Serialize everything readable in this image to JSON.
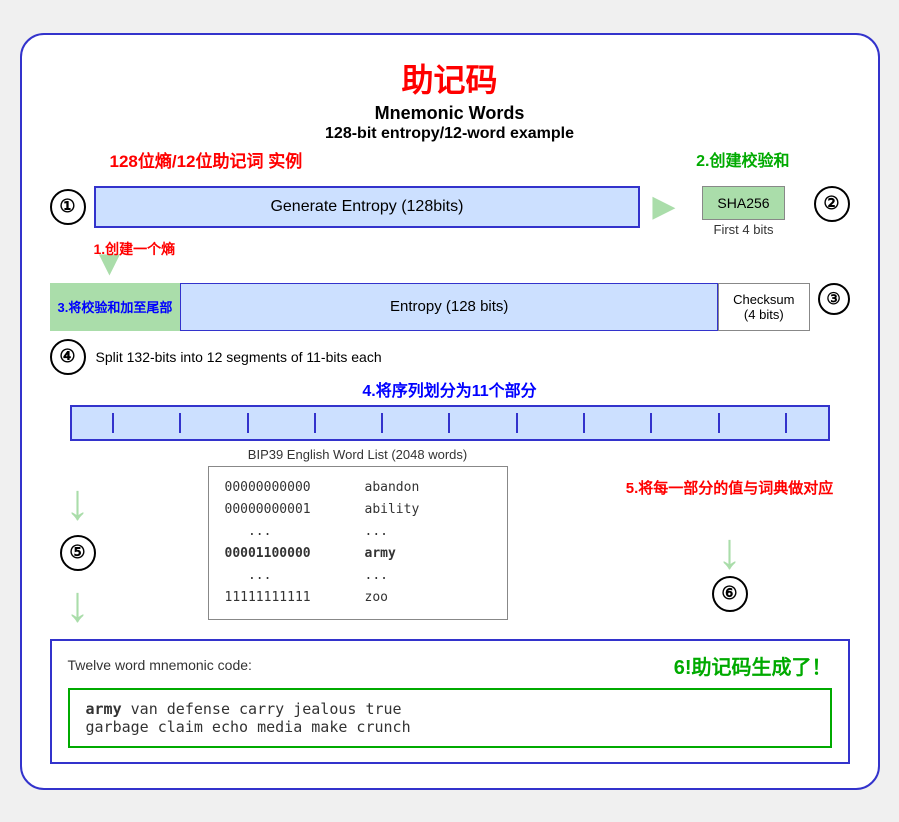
{
  "title": {
    "cn": "助记码",
    "en1": "Mnemonic Words",
    "en2": "128-bit entropy/12-word example",
    "cn2_left": "128位熵/12位助记词 实例",
    "cn2_right": "2.创建校验和"
  },
  "steps": {
    "step1_label": "1.创建一个熵",
    "step2_label": "2.创建校验和",
    "step3_label": "3.将校验和加至尾部",
    "step4_en": "Split 132-bits into 12 segments of 11-bits each",
    "step4_cn": "4.将序列划分为11个部分",
    "step5_cn": "5.将每一部分的值与词典做对应",
    "step6_cn": "6!助记码生成了！"
  },
  "boxes": {
    "generate_entropy": "Generate Entropy (128bits)",
    "sha256": "SHA256",
    "first4bits": "First 4 bits",
    "entropy128": "Entropy (128 bits)",
    "checksum": "Checksum\n(4 bits)",
    "twelve_word_label": "Twelve word mnemonic code:"
  },
  "wordlist": {
    "title": "BIP39 English Word List (2048 words)",
    "rows": [
      {
        "bits": "00000000000",
        "word": "abandon"
      },
      {
        "bits": "00000000001",
        "word": "ability"
      },
      {
        "bits": "...",
        "word": "..."
      },
      {
        "bits": "00001100000",
        "word": "army",
        "highlight": true
      },
      {
        "bits": "...",
        "word": "..."
      },
      {
        "bits": "11111111111",
        "word": "zoo"
      }
    ]
  },
  "mnemonic": {
    "words": "army van defense carry jealous true garbage claim echo media make crunch",
    "bold_word": "army"
  },
  "circle_nums": [
    "①",
    "②",
    "③",
    "④",
    "⑤",
    "⑥"
  ],
  "colors": {
    "blue_border": "#3333cc",
    "light_blue": "#cce0ff",
    "green_bg": "#aaddaa",
    "red": "#ff0000",
    "green_text": "#00aa00",
    "blue_text": "#0000ff"
  }
}
